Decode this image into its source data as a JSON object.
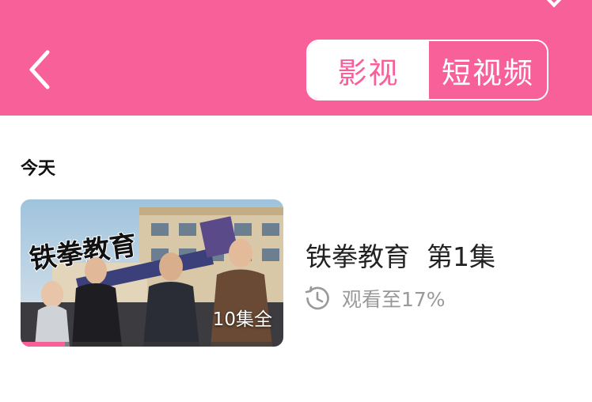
{
  "header": {
    "tabs": [
      {
        "label": "影视",
        "selected": true
      },
      {
        "label": "短视频",
        "selected": false
      }
    ],
    "back_icon": "chevron-left-icon",
    "accent": "#f8609a"
  },
  "section": {
    "label": "今天"
  },
  "history_items": [
    {
      "thumbnail_title": "铁拳教育",
      "episode_count": "10集全",
      "title": "铁拳教育  第1集",
      "progress_text": "观看至17%",
      "progress": 0.17,
      "icon": "history-clock-icon"
    }
  ]
}
